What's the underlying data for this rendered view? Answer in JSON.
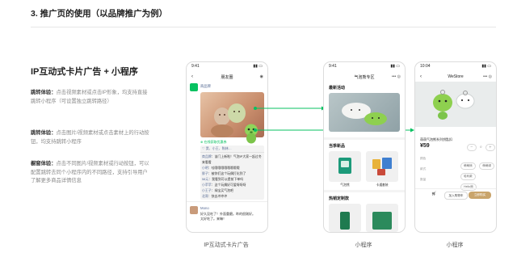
{
  "page": {
    "section_title": "3. 推广页的使用（以品牌推广为例）",
    "heading": "IP互动式卡片广告 + 小程序",
    "paragraphs": [
      {
        "label": "跳转体验：",
        "text": "点击视频素材或点击IP形象，均支持直接跳转小程序（可设置独立跳转路径）"
      },
      {
        "label": "跳转体验：",
        "text": "点击图片/视频素材或点击素材上的行动按钮，均支持跳转小程序"
      },
      {
        "label": "橱窗体验：",
        "text": "点击不同图片/视频素材或行动按钮，可以配置跳转去同个小程序内的不同路径，支持引导用户了解更多商品详情信息"
      }
    ],
    "captions": [
      "IP互动式卡片广告",
      "小程序",
      "小程序"
    ]
  },
  "phone1": {
    "time": "9:41",
    "nav_title": "朋友圈",
    "poster_name": "商品牌",
    "link_text": "在线获取优惠券",
    "likes": "昊、小王、陈林…",
    "comments": [
      {
        "name": "商品牌",
        "text": "该门上新啦！气泡IP大家一起过冬来看看"
      },
      {
        "name": "小明",
        "text": "哇哦哦哦哦哦哦哦哦"
      },
      {
        "name": "胖子",
        "text": "被你们这个玩偶打化到了"
      },
      {
        "name": "58元",
        "text": "我看到可以提前下单吗"
      },
      {
        "name": "小苹苹",
        "text": "这个玩偶好可爱呀呀呀"
      },
      {
        "name": "小王子",
        "text": "绿宝买气泡吧"
      },
      {
        "name": "北哥",
        "text": "快去冲冲冲"
      }
    ],
    "second_post": {
      "name": "Mono",
      "text": "好久没吃了！外面重磨。昨的很刚好。太好吃了。来嘛！"
    }
  },
  "phone2": {
    "time": "9:41",
    "nav_title": "气泡熊专区",
    "section_latest": "最新活动",
    "section_products": "当季新品",
    "product_labels": [
      "气泡熊",
      "卡通套装"
    ],
    "section_custom": "热销定制款"
  },
  "phone3": {
    "time": "10:04",
    "nav_title": "WeStore",
    "product_name": "萌萌气泡熊系列钥匙扣",
    "price": "¥59",
    "option_rows": [
      "颜色",
      "款式",
      "数量"
    ],
    "option_chips": [
      "萌萌熊",
      "萌萌绿",
      "哈利款",
      "Hello熊"
    ],
    "buy_button": "立即购买",
    "cart_button": "加入购物车"
  },
  "colors": {
    "accent": "#07c160",
    "buy": "#c9a46b"
  }
}
